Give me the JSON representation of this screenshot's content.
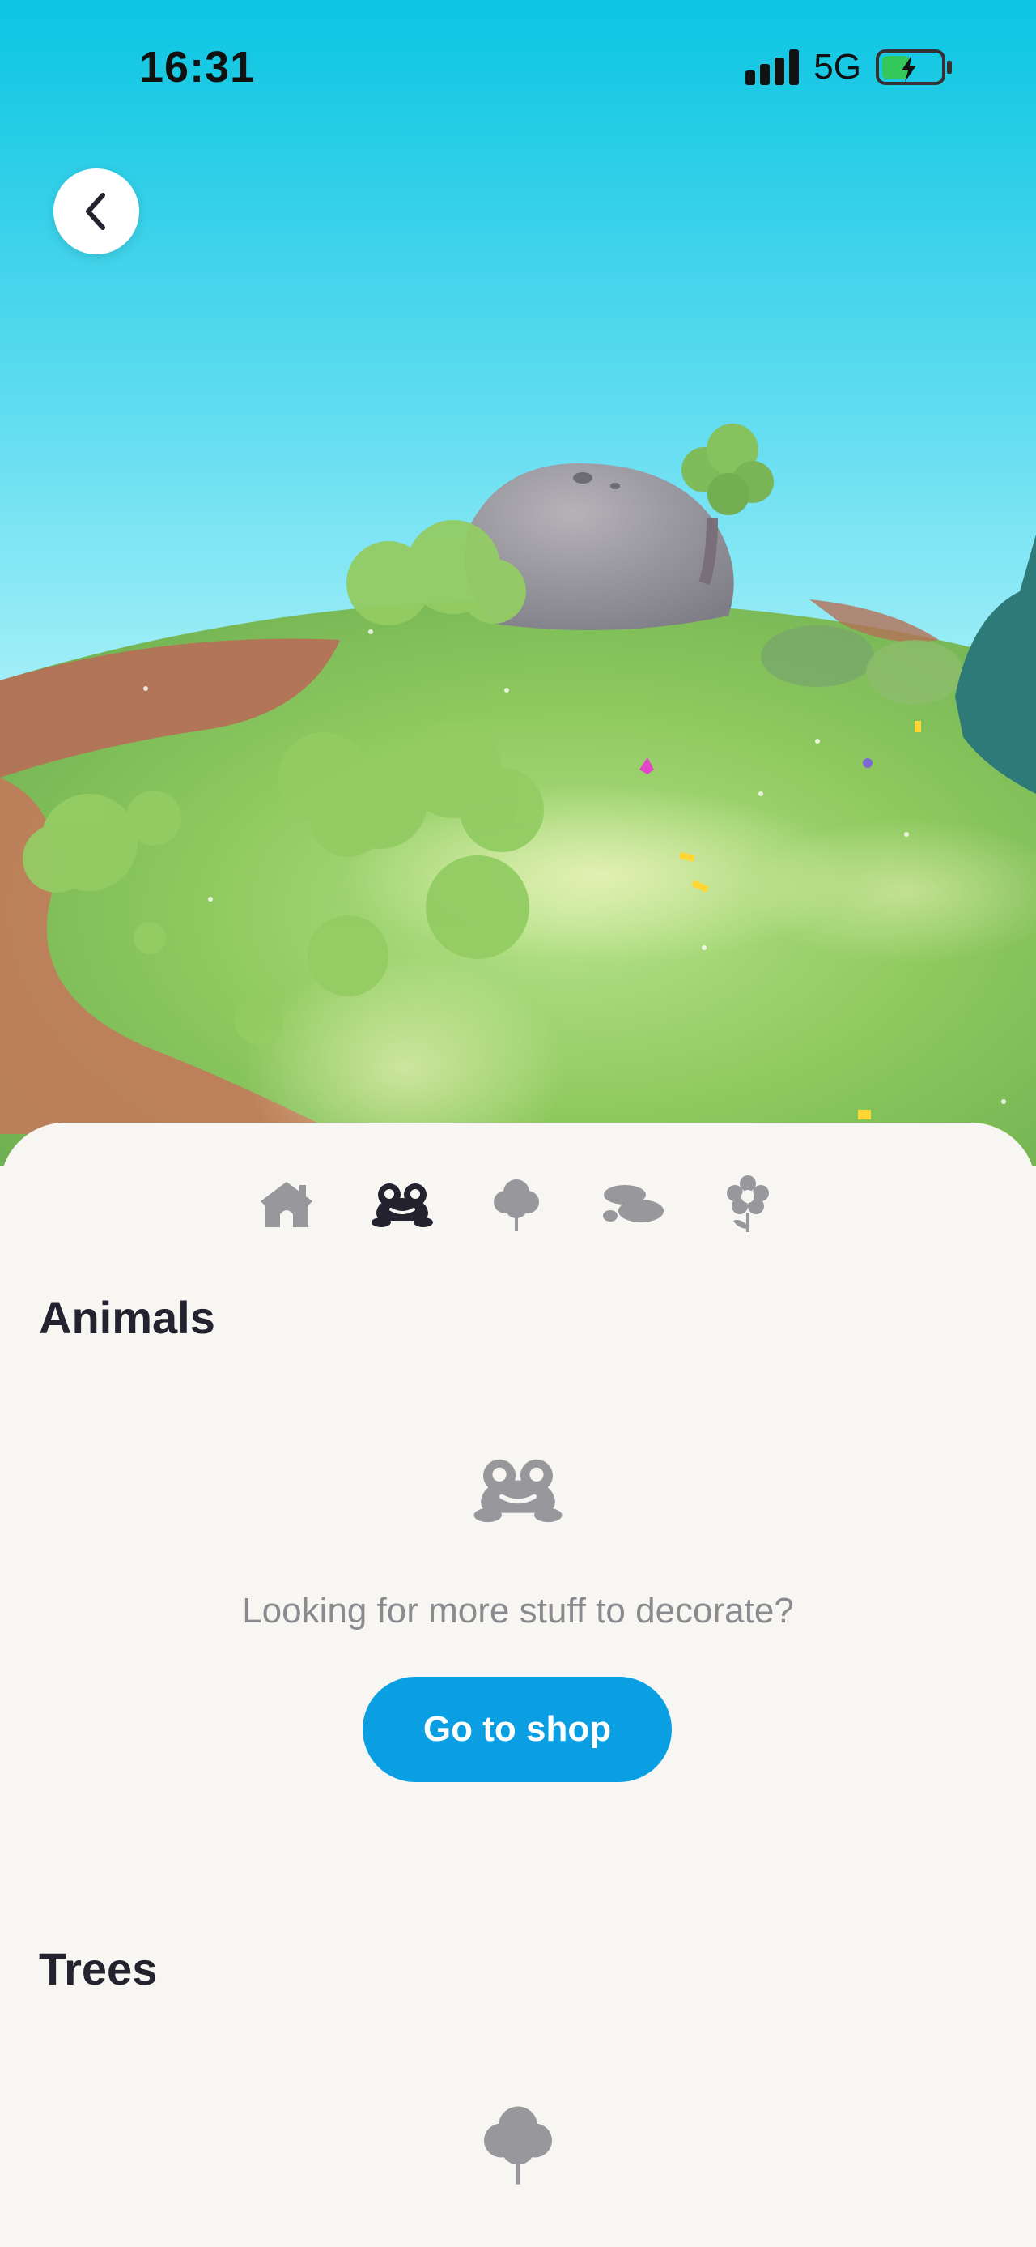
{
  "status_bar": {
    "time": "16:31",
    "network": "5G"
  },
  "tabs": [
    {
      "name": "house",
      "active": false
    },
    {
      "name": "animals",
      "active": true
    },
    {
      "name": "trees",
      "active": false
    },
    {
      "name": "rocks",
      "active": false
    },
    {
      "name": "flowers",
      "active": false
    }
  ],
  "sections": {
    "animals": {
      "title": "Animals",
      "empty_text": "Looking for more stuff to decorate?",
      "button_label": "Go to shop"
    },
    "trees": {
      "title": "Trees"
    }
  },
  "colors": {
    "accent": "#0a9fe3",
    "tab_active": "#23222e",
    "tab_inactive": "#98979c",
    "sheet_bg": "#f8f6f2"
  }
}
